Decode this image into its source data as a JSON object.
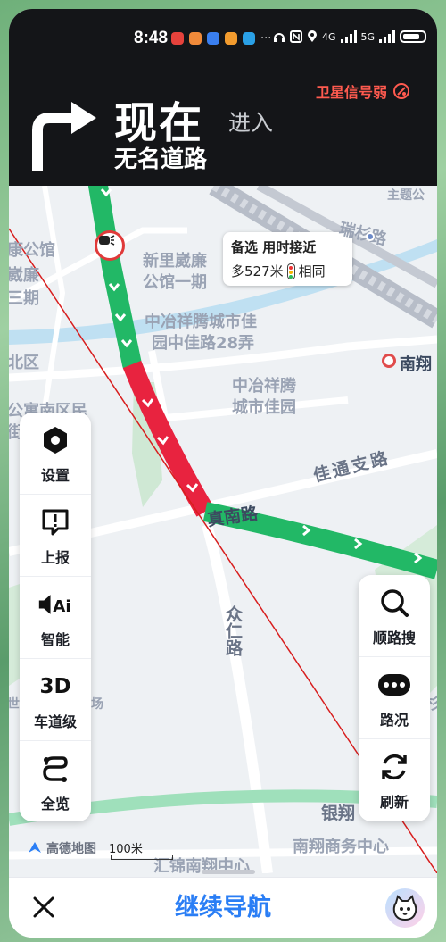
{
  "status_bar": {
    "time": "8:48",
    "network_4g": "4G",
    "network_5g": "5G"
  },
  "navigation": {
    "instruction_main": "现在",
    "instruction_action": "进入",
    "road_name": "无名道路",
    "gps_warning": "卫星信号弱",
    "turn_icon": "right-turn-arrow-icon"
  },
  "map": {
    "labels": {
      "poi_top_right": "主题公",
      "area_top_right": "瑞杉路",
      "area_left1": "康公馆",
      "area_left2": "崴廉",
      "area_left3": "三期",
      "community1": "新里崴廉",
      "community1b": "公馆一期",
      "community2": "中冶祥腾城市佳",
      "community2b": "园中佳路28弄",
      "community3": "中冶祥腾",
      "community3b": "城市佳园",
      "area_left4": "北区",
      "area_left5": "公寓南区民",
      "area_left6": "街",
      "metro": "南翔",
      "area_bottom_left": "世",
      "area_bottom_left2": "场",
      "area_bottom_right": "杉",
      "road_zhennan": "真南路",
      "road_jiatong": "佳通支路",
      "road_zhongren": "众仁路",
      "road_yinxiang": "银翔",
      "poi_bottom1": "汇锦南翔中心",
      "poi_bottom2": "南翔商务中心"
    },
    "alt_route": {
      "title": "备选 用时接近",
      "distance": "多527米",
      "via": "相同"
    },
    "brand": "高德地图",
    "scale": "100米"
  },
  "left_panel": {
    "items": [
      {
        "label": "设置",
        "icon": "settings-icon"
      },
      {
        "label": "上报",
        "icon": "report-icon"
      },
      {
        "label": "智能",
        "icon": "ai-voice-icon"
      },
      {
        "label": "车道级",
        "icon": "3d-lane-icon",
        "icon_text": "3D"
      },
      {
        "label": "全览",
        "icon": "overview-icon"
      }
    ]
  },
  "right_panel": {
    "items": [
      {
        "label": "顺路搜",
        "icon": "search-icon"
      },
      {
        "label": "路况",
        "icon": "traffic-icon"
      },
      {
        "label": "刷新",
        "icon": "refresh-icon"
      }
    ]
  },
  "bottom_bar": {
    "continue_label": "继续导航",
    "close_icon": "close-icon",
    "assistant_icon": "assistant-avatar-icon"
  },
  "colors": {
    "route_green": "#22b866",
    "route_red": "#e8233f",
    "header_bg": "#141518",
    "accent_blue": "#2a7ef5",
    "warning_red": "#ff5a4f"
  }
}
